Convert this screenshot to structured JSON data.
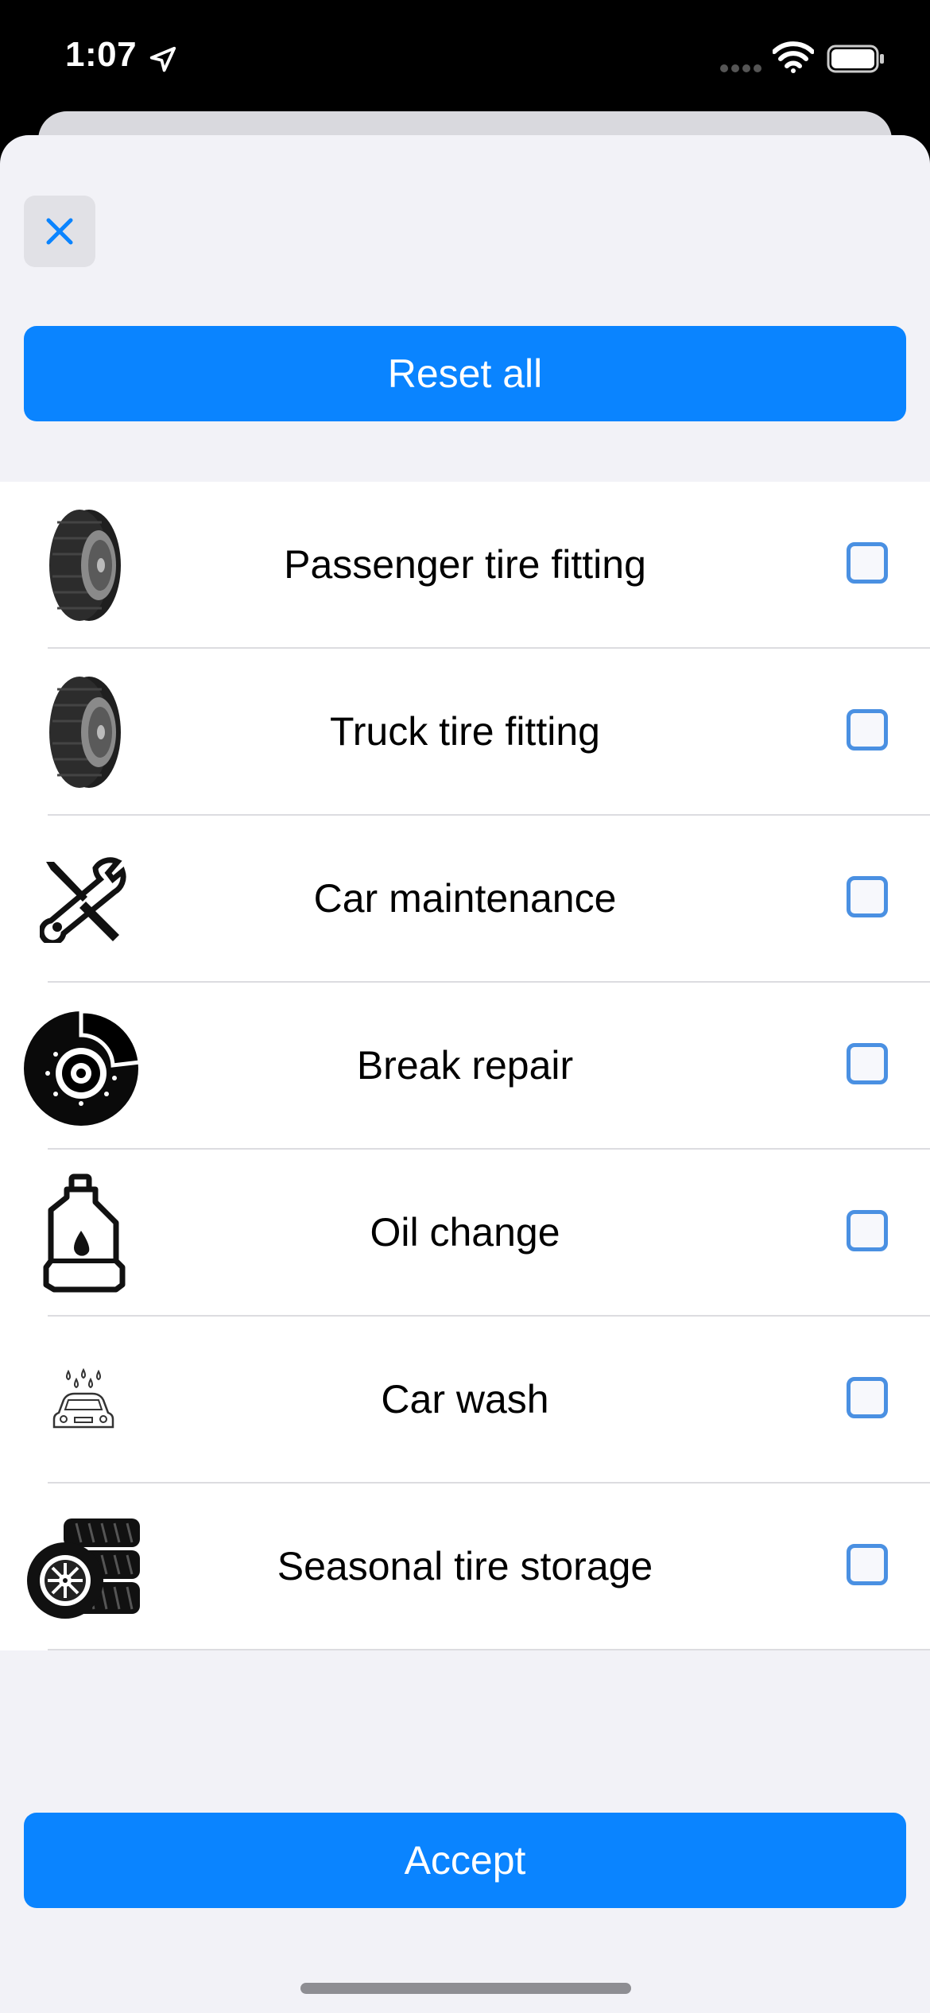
{
  "status_bar": {
    "time": "1:07"
  },
  "sheet": {
    "reset_label": "Reset all",
    "accept_label": "Accept"
  },
  "services": [
    {
      "label": "Passenger tire fitting",
      "icon": "tire-icon",
      "checked": false
    },
    {
      "label": "Truck tire fitting",
      "icon": "tire-icon",
      "checked": false
    },
    {
      "label": "Car maintenance",
      "icon": "wrench-screwdriver-icon",
      "checked": false
    },
    {
      "label": "Break repair",
      "icon": "brake-disc-icon",
      "checked": false
    },
    {
      "label": "Oil change",
      "icon": "oil-canister-icon",
      "checked": false
    },
    {
      "label": "Car wash",
      "icon": "car-wash-icon",
      "checked": false
    },
    {
      "label": "Seasonal tire storage",
      "icon": "tire-stack-icon",
      "checked": false
    }
  ],
  "colors": {
    "accent": "#0a84ff",
    "checkbox_border": "#4a90e2",
    "sheet_bg": "#f2f2f7"
  }
}
